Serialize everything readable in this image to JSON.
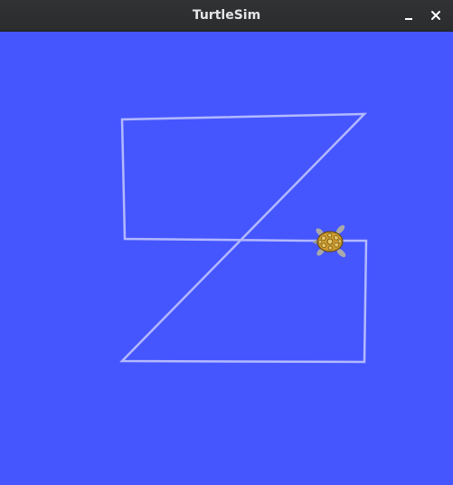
{
  "window": {
    "title": "TurtleSim"
  },
  "titlebar_buttons": {
    "minimize_icon": "minimize-icon",
    "close_icon": "close-icon"
  },
  "canvas": {
    "background_color": "#4556ff",
    "pen_color": "#b3b8ff"
  },
  "turtle": {
    "icon": "turtle-icon"
  }
}
